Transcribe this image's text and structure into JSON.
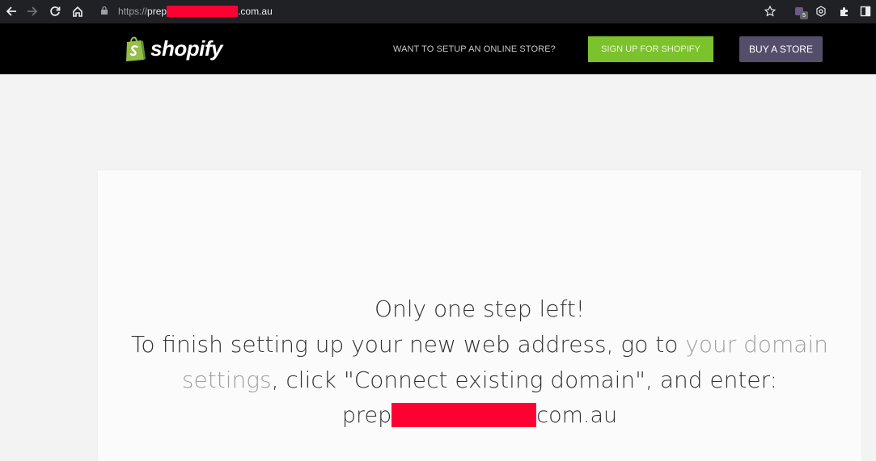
{
  "browser": {
    "url_scheme": "https://",
    "url_prefix": "prep",
    "url_suffix": ".com.au",
    "extension_badge": "5"
  },
  "header": {
    "logo_text": "shopify",
    "want_text": "WANT TO SETUP AN ONLINE STORE?",
    "signup_label": "SIGN UP FOR SHOPIFY",
    "buy_label": "BUY A STORE"
  },
  "main": {
    "heading": "Only one step left!",
    "text_before_link": "To finish setting up your new web address, go to ",
    "link_text": "your domain settings",
    "text_after_link": ", click \"Connect existing domain\", and enter:",
    "domain_prefix": "prep",
    "domain_suffix": "com.au"
  },
  "colors": {
    "signup_bg": "#7cc22c",
    "buy_bg": "#554e6b",
    "header_bg": "#000000",
    "redaction": "#ff0033"
  }
}
